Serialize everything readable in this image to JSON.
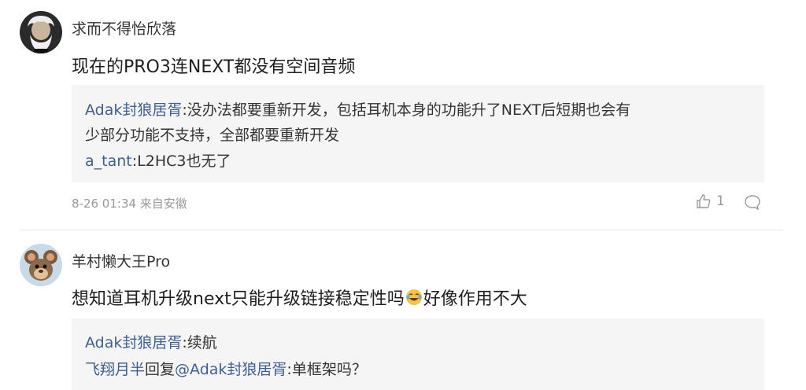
{
  "comments": [
    {
      "username": "求而不得怡欣落",
      "text": "现在的PRO3连NEXT都没有空间音频",
      "replies": [
        {
          "author": "Adak封狼居胥",
          "sep": ":",
          "text": "没办法都要重新开发，包括耳机本身的功能升了NEXT后短期也会有"
        },
        {
          "continuation": "少部分功能不支持，全部都要重新开发"
        },
        {
          "author": "a_tant",
          "sep": ":",
          "text": "L2HC3也无了"
        }
      ],
      "time_location": "8-26 01:34 来自安徽",
      "likes": "1"
    },
    {
      "username": "羊村懒大王Pro",
      "text_before_emoji": "想知道耳机升级next只能升级链接稳定性吗",
      "text_after_emoji": "好像作用不大",
      "replies": [
        {
          "author": "Adak封狼居胥",
          "sep": ":",
          "text": "续航"
        },
        {
          "author": "飞翔月半",
          "reply_word": "回复",
          "mention": "@Adak封狼居胥",
          "sep": ":",
          "text": "单框架吗？"
        }
      ]
    }
  ],
  "icons": {
    "avatar1": "portrait-avatar",
    "avatar2": "cartoon-mouse-avatar",
    "like": "thumbs-up-icon",
    "comment": "comment-bubble-icon",
    "emoji": "laughing-tears-emoji"
  },
  "colors": {
    "link": "#3f5f92",
    "reply_bg": "#f5f5f5",
    "meta": "#999999"
  }
}
